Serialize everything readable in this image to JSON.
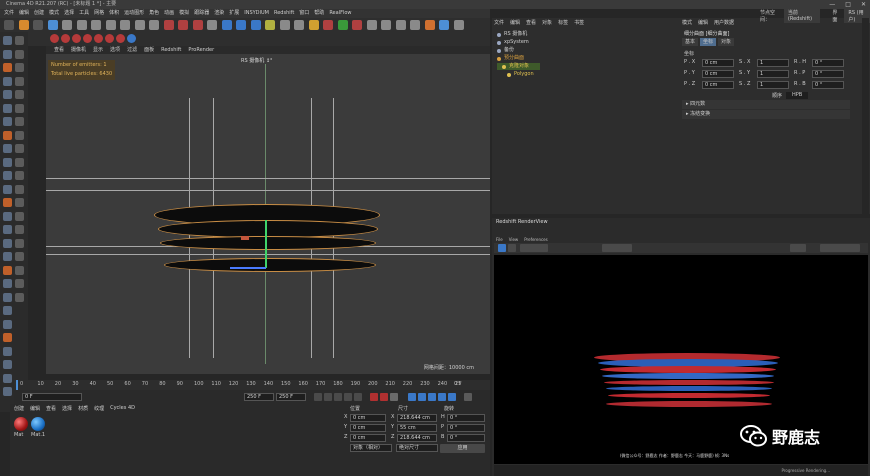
{
  "window": {
    "title": "Cinema 4D R21.207 (RC) - [未标题 1 *] - 主要",
    "controls": [
      "—",
      "□",
      "✕"
    ]
  },
  "menubar": [
    "文件",
    "编辑",
    "创建",
    "模式",
    "选择",
    "工具",
    "网格",
    "体积",
    "运动图形",
    "角色",
    "动画",
    "模拟",
    "跟踪器",
    "渲染",
    "扩展",
    "INSYDIUM",
    "Redshift",
    "窗口",
    "帮助",
    "RealFlow"
  ],
  "viewport": {
    "menu": [
      "查看",
      "摄像机",
      "显示",
      "选项",
      "过滤",
      "面板",
      "Redshift",
      "ProRender"
    ],
    "camera_label": "RS 摄像机 ↕°",
    "hud_lines": [
      "Number of emitters: 1",
      "Total live particles: 6430"
    ],
    "grid_info": "网格间距：10000 cm"
  },
  "timeline": {
    "ticks": [
      "0",
      "10",
      "20",
      "30",
      "40",
      "50",
      "60",
      "70",
      "80",
      "90",
      "100",
      "110",
      "120",
      "130",
      "140",
      "150",
      "160",
      "170",
      "180",
      "190",
      "200",
      "210",
      "220",
      "230",
      "240",
      "25"
    ],
    "end_frame": "0 F"
  },
  "playbar": {
    "current_frame": "0 F",
    "start_field": "0 F",
    "end_field": "250 F",
    "end_field2": "250 F"
  },
  "materials": {
    "menu": [
      "创建",
      "编辑",
      "查看",
      "选择",
      "材质",
      "纹理",
      "Cycles 4D"
    ],
    "items": [
      {
        "label": "Mat",
        "color": "#b02020"
      },
      {
        "label": "Mat.1",
        "color": "#1f7fd6"
      }
    ]
  },
  "coords": {
    "headers": [
      "位置",
      "尺寸",
      "旋转"
    ],
    "rows": [
      {
        "axis": "X",
        "pos": "0 cm",
        "size_axis": "X",
        "size": "218.644 cm",
        "rot_axis": "H",
        "rot": "0 °"
      },
      {
        "axis": "Y",
        "pos": "0 cm",
        "size_axis": "Y",
        "size": "55 cm",
        "rot_axis": "P",
        "rot": "0 °"
      },
      {
        "axis": "Z",
        "pos": "0 cm",
        "size_axis": "Z",
        "size": "218.644 cm",
        "rot_axis": "B",
        "rot": "0 °"
      }
    ],
    "mode1": "对象（相对）",
    "mode2": "绝对尺寸",
    "apply": "应用"
  },
  "objects": {
    "menu": [
      "文件",
      "编辑",
      "查看",
      "对象",
      "标签",
      "书签"
    ],
    "rows": [
      {
        "name": "RS 摄像机",
        "color": "#9aa7c2",
        "indent": 0
      },
      {
        "name": "xpSystem",
        "color": "#9aa7c2",
        "indent": 0
      },
      {
        "name": "备份",
        "color": "#9aa7c2",
        "indent": 0
      },
      {
        "name": "预分曲面",
        "color": "#d8a040",
        "indent": 0
      },
      {
        "name": "克隆对象",
        "color": "#e0c050",
        "indent": 1
      },
      {
        "name": "Polygon",
        "color": "#e0c050",
        "indent": 2
      }
    ]
  },
  "attributes": {
    "header": [
      "模式",
      "编辑",
      "用户数据"
    ],
    "node_label": "节点空间：",
    "node_value": "当前 (Redshift)",
    "layer_label": "界面",
    "layer_value": "RS (用户)",
    "object_title": "细分曲面 [细分曲面]",
    "tabs": [
      "基本",
      "坐标",
      "对象"
    ],
    "section_coords": "坐标",
    "fields": [
      {
        "label": "P . X",
        "value": "0 cm"
      },
      {
        "label": "S . X",
        "value": "1"
      },
      {
        "label": "R . H",
        "value": "0 °"
      },
      {
        "label": "P . Y",
        "value": "0 cm"
      },
      {
        "label": "S . Y",
        "value": "1"
      },
      {
        "label": "R . P",
        "value": "0 °"
      },
      {
        "label": "P . Z",
        "value": "0 cm"
      },
      {
        "label": "S . Z",
        "value": "1"
      },
      {
        "label": "R . B",
        "value": "0 °"
      }
    ],
    "order_label": "顺序",
    "order_value": "HPB",
    "section_freeze": "冻结变换",
    "section_object": "▸ 四元数",
    "section_extra": "▸ 冻结变换"
  },
  "renderview": {
    "title": "Redshift RenderView",
    "menu": [
      "File",
      "View",
      "Preferences"
    ],
    "caption": "(微信公众号：野鹿志  作者：野鹿志  今天：马鹿野鹿)  帧: 3Ns",
    "status": "Progressive Rendering...",
    "watermark": "野鹿志"
  }
}
